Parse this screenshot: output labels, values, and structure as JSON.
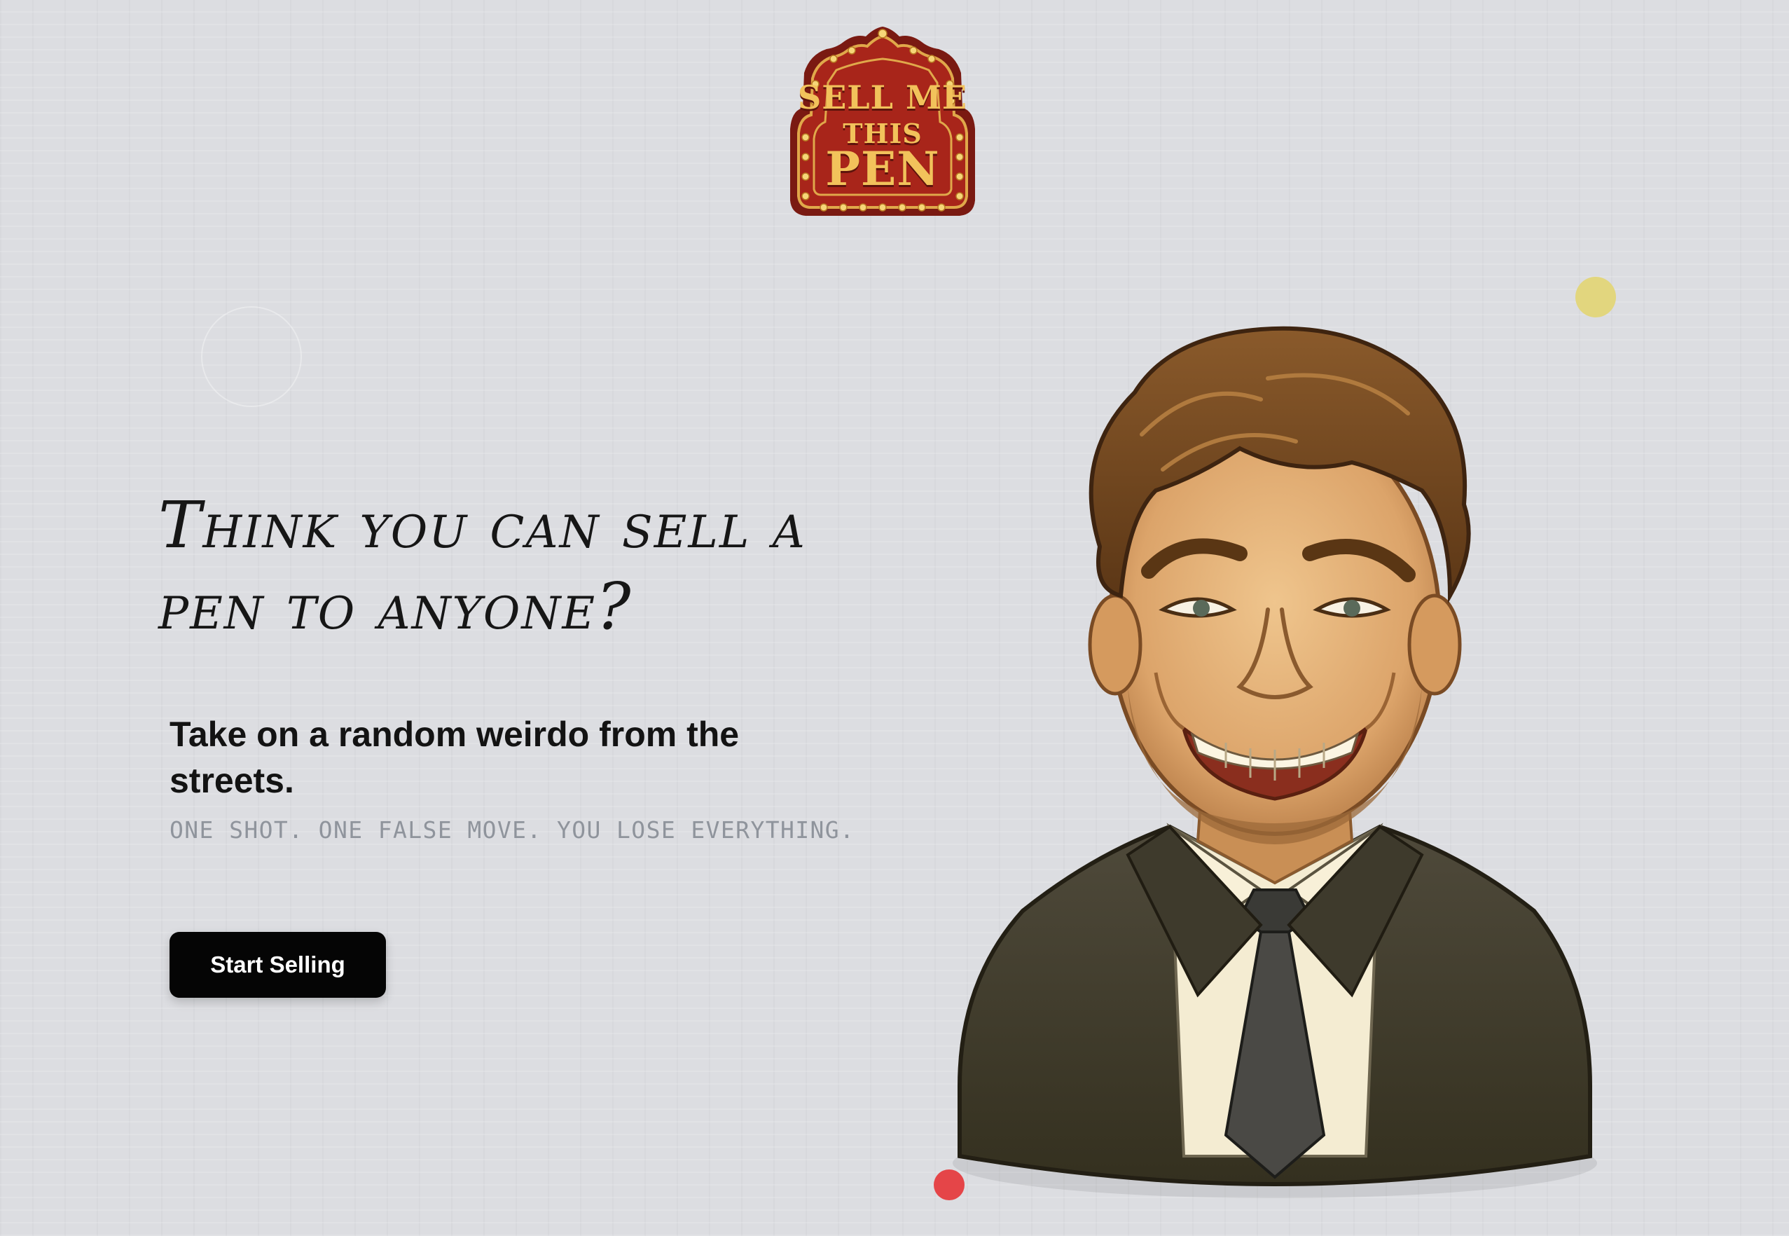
{
  "logo": {
    "line1": "SELL ME",
    "line2": "THIS",
    "line3": "PEN"
  },
  "hero": {
    "title": "Think you can sell a pen to anyone?",
    "subtitle": "Take on a random weirdo from the streets.",
    "tagline": "ONE SHOT. ONE FALSE MOVE. YOU LOSE EVERYTHING.",
    "cta_label": "Start Selling"
  },
  "colors": {
    "background": "#dcdde1",
    "sign_red": "#a8251a",
    "sign_gold": "#f2c25b",
    "button": "#050505",
    "accent_yellow": "#e2d67e",
    "accent_red": "#e54548"
  },
  "icons": {
    "logo": "marquee-sign-logo",
    "character": "smiling-salesman-illustration"
  }
}
